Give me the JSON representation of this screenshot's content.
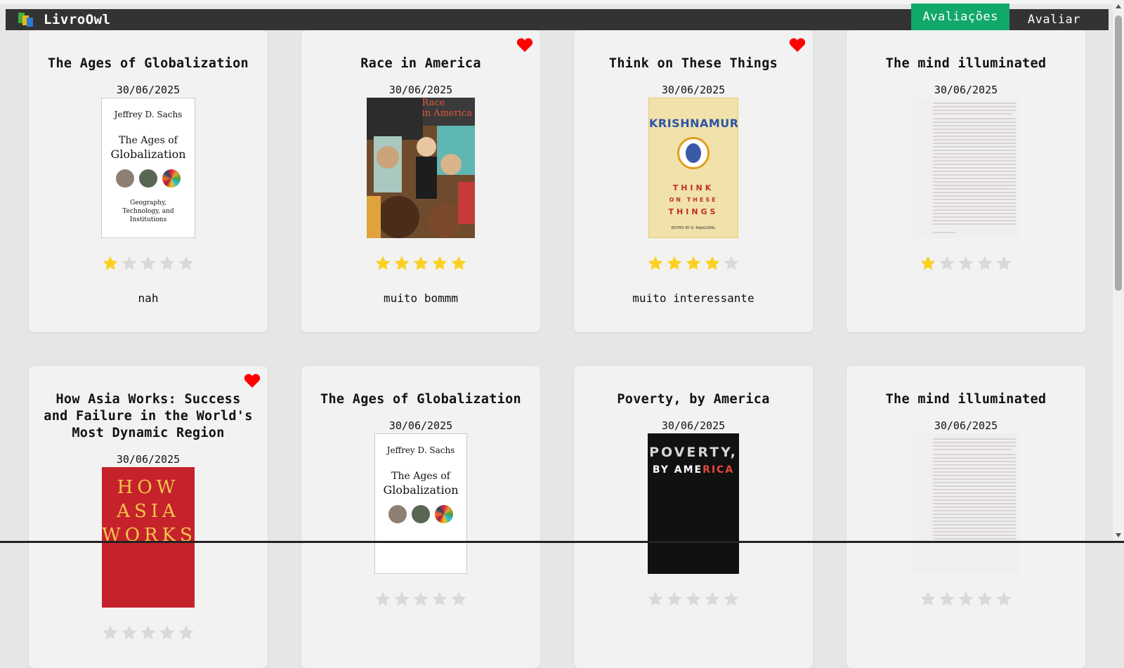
{
  "app": {
    "name": "LivroOwl",
    "nav": {
      "active": "Avaliações",
      "other": "Avaliar"
    }
  },
  "colors": {
    "navbar": "#333333",
    "accent": "#11a86a",
    "heart": "#ff0000",
    "star_filled": "#fcd021",
    "star_empty": "#d9d9d9"
  },
  "reviews": [
    {
      "title": "The Ages of Globalization",
      "date": "30/06/2025",
      "rating": 1,
      "favorite": false,
      "comment": "nah",
      "cover": {
        "author": "Jeffrey D. Sachs",
        "title_line1": "The Ages of",
        "title_line2": "Globalization",
        "subtitle": "Geography, Technology, and Institutions"
      }
    },
    {
      "title": "Race in America",
      "date": "30/06/2025",
      "rating": 5,
      "favorite": true,
      "comment": "muito bommm",
      "cover": {
        "title_line1": "Race",
        "title_line2": "in America"
      }
    },
    {
      "title": "Think on These Things",
      "date": "30/06/2025",
      "rating": 4,
      "favorite": true,
      "comment": "muito interessante",
      "cover": {
        "author": "KRISHNAMURTI",
        "line1": "THINK",
        "line2": "ON THESE",
        "line3": "THINGS",
        "editor": "EDITED BY D. RAJAGOPAL"
      }
    },
    {
      "title": "The mind illuminated",
      "date": "30/06/2025",
      "rating": 1,
      "favorite": false,
      "comment": "",
      "cover": {}
    },
    {
      "title": "How Asia Works: Success and Failure in the World's Most Dynamic Region",
      "date": "30/06/2025",
      "rating": 0,
      "favorite": true,
      "comment": "",
      "cover": {
        "line1": "HOW",
        "line2": "ASIA",
        "line3": "WORKS"
      }
    },
    {
      "title": "The Ages of Globalization",
      "date": "30/06/2025",
      "rating": 0,
      "favorite": false,
      "comment": "",
      "cover": {
        "author": "Jeffrey D. Sachs",
        "title_line1": "The Ages of",
        "title_line2": "Globalization"
      }
    },
    {
      "title": "Poverty, by America",
      "date": "30/06/2025",
      "rating": 0,
      "favorite": false,
      "comment": "",
      "cover": {
        "line1": "POVERTY,",
        "line2a": "BY AME",
        "line2b": "RICA"
      }
    },
    {
      "title": "The mind illuminated",
      "date": "30/06/2025",
      "rating": 0,
      "favorite": false,
      "comment": "",
      "cover": {}
    }
  ]
}
